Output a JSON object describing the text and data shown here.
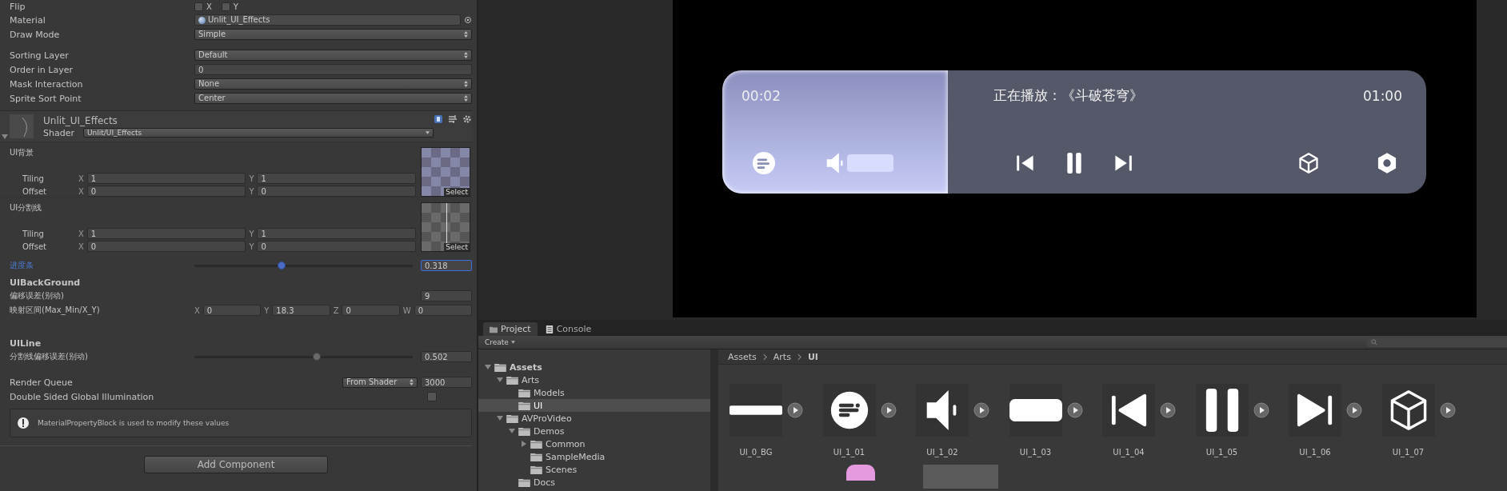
{
  "inspector": {
    "flip": {
      "label": "Flip",
      "options": [
        {
          "label": "X",
          "checked": false
        },
        {
          "label": "Y",
          "checked": false
        }
      ]
    },
    "property_groups": [
      [
        {
          "kind": "object",
          "label": "Material",
          "value": "Unlit_UI_Effects"
        },
        {
          "kind": "dropdown",
          "label": "Draw Mode",
          "value": "Simple"
        }
      ],
      [
        {
          "kind": "dropdown",
          "label": "Sorting Layer",
          "value": "Default"
        },
        {
          "kind": "text",
          "label": "Order in Layer",
          "value": "0"
        },
        {
          "kind": "dropdown",
          "label": "Mask Interaction",
          "value": "None"
        },
        {
          "kind": "dropdown",
          "label": "Sprite Sort Point",
          "value": "Center"
        }
      ]
    ],
    "material": {
      "name": "Unlit_UI_Effects",
      "shader_label": "Shader",
      "shader": "Unlit/UI_Effects",
      "expanded": true
    },
    "textures": [
      {
        "label": "UI背景",
        "kind": "background",
        "button": "Select",
        "rows": [
          {
            "label": "Tiling",
            "components": [
              {
                "axis": "X",
                "value": "1"
              },
              {
                "axis": "Y",
                "value": "1"
              }
            ]
          },
          {
            "label": "Offset",
            "components": [
              {
                "axis": "X",
                "value": "0"
              },
              {
                "axis": "Y",
                "value": "0"
              }
            ]
          }
        ]
      },
      {
        "label": "UI分割线",
        "kind": "divider",
        "button": "Select",
        "rows": [
          {
            "label": "Tiling",
            "components": [
              {
                "axis": "X",
                "value": "1"
              },
              {
                "axis": "Y",
                "value": "1"
              }
            ]
          },
          {
            "label": "Offset",
            "components": [
              {
                "axis": "X",
                "value": "0"
              },
              {
                "axis": "Y",
                "value": "0"
              }
            ]
          }
        ]
      }
    ],
    "progress": {
      "label": "进度条",
      "level": 0.4,
      "value": "0.318",
      "focused": true
    },
    "sections": [
      {
        "heading": "UIBackGround",
        "rows": [
          {
            "kind": "number",
            "label": "偏移误差(别动)",
            "value": "9"
          },
          {
            "kind": "vector",
            "label": "映射区间(Max_Min/X_Y)",
            "components": [
              {
                "axis": "X",
                "value": "0"
              },
              {
                "axis": "Y",
                "value": "18.3"
              },
              {
                "axis": "Z",
                "value": "0"
              },
              {
                "axis": "W",
                "value": "0"
              }
            ]
          }
        ]
      },
      {
        "heading": "UILine",
        "rows": [
          {
            "kind": "slider",
            "label": "分割线偏移误差(别动)",
            "level": 0.56,
            "value": "0.502"
          }
        ]
      }
    ],
    "render_queue": {
      "label": "Render Queue",
      "mode": "From Shader",
      "value": "3000"
    },
    "double_sided": {
      "label": "Double Sided Global Illumination",
      "checked": false
    },
    "help": "MaterialPropertyBlock is used to modify these values",
    "add_component": "Add Component"
  },
  "player": {
    "elapsed": "00:02",
    "title": "正在播放：《斗破苍穹》",
    "duration": "01:00",
    "progress": {
      "level": 0.32
    },
    "volume": {
      "level": 1
    }
  },
  "project": {
    "tabs": [
      {
        "label": "Project",
        "selected": true
      },
      {
        "label": "Console",
        "selected": false
      }
    ],
    "create": "Create",
    "tree": [
      {
        "label": "Assets",
        "expanded": true,
        "selected": false,
        "children": [
          {
            "label": "Arts",
            "expanded": true,
            "selected": false,
            "children": [
              {
                "label": "Models",
                "selected": false
              },
              {
                "label": "UI",
                "selected": true
              }
            ]
          },
          {
            "label": "AVProVideo",
            "expanded": true,
            "selected": false,
            "children": [
              {
                "label": "Demos",
                "expanded": true,
                "selected": false,
                "children": [
                  {
                    "label": "Common",
                    "expanded": false,
                    "selected": false
                  },
                  {
                    "label": "SampleMedia",
                    "selected": false
                  },
                  {
                    "label": "Scenes",
                    "selected": false
                  }
                ]
              },
              {
                "label": "Docs",
                "selected": false
              }
            ]
          }
        ]
      }
    ],
    "breadcrumb": [
      "Assets",
      "Arts",
      "UI"
    ],
    "assets": [
      {
        "name": "UI_0_BG",
        "kind": "bar"
      },
      {
        "name": "UI_1_01",
        "kind": "list"
      },
      {
        "name": "UI_1_02",
        "kind": "speaker"
      },
      {
        "name": "UI_1_03",
        "kind": "pill"
      },
      {
        "name": "UI_1_04",
        "kind": "prev"
      },
      {
        "name": "UI_1_05",
        "kind": "pause"
      },
      {
        "name": "UI_1_06",
        "kind": "next"
      },
      {
        "name": "UI_1_07",
        "kind": "cube"
      }
    ]
  }
}
